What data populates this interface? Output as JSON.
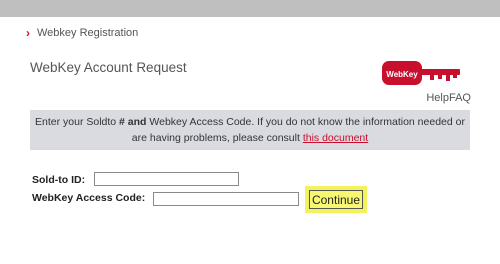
{
  "breadcrumb": {
    "label": "Webkey Registration"
  },
  "page": {
    "title": "WebKey Account Request"
  },
  "logo": {
    "text": "WebKey"
  },
  "help": {
    "help": "Help",
    "faq": "FAQ"
  },
  "notice": {
    "text_before": "Enter your Soldto ",
    "bold": "# and",
    "text_middle": " Webkey Access Code. If you do not know the information needed or are having problems, please consult ",
    "link": "this document"
  },
  "form": {
    "soldto_label": "Sold-to ID:",
    "soldto_value": "",
    "access_label": "WebKey Access Code:",
    "access_value": "",
    "continue_label": "Continue"
  },
  "colors": {
    "accent": "#c8102e",
    "highlight": "#f4f25a",
    "notice_bg": "#d9dbe1"
  }
}
